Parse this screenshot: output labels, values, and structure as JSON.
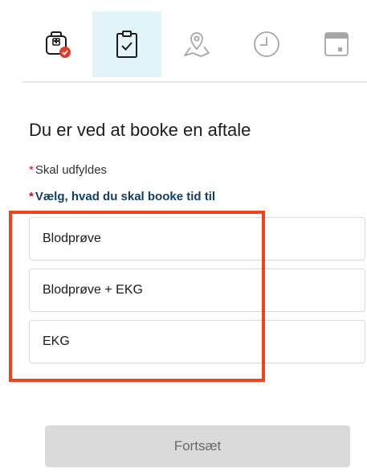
{
  "steps": [
    {
      "icon": "medical-bag-icon",
      "state": "completed"
    },
    {
      "icon": "clipboard-check-icon",
      "state": "active"
    },
    {
      "icon": "map-location-icon",
      "state": "upcoming"
    },
    {
      "icon": "clock-icon",
      "state": "upcoming"
    },
    {
      "icon": "calendar-icon",
      "state": "upcoming"
    }
  ],
  "heading": "Du er ved at booke en aftale",
  "required_note": {
    "star": "*",
    "label": "Skal udfyldes"
  },
  "question": {
    "star": "*",
    "label": "Vælg, hvad du skal booke tid til"
  },
  "options": [
    {
      "label": "Blodprøve"
    },
    {
      "label": "Blodprøve + EKG"
    },
    {
      "label": "EKG"
    }
  ],
  "continue_button": {
    "label": "Fortsæt",
    "enabled": false
  },
  "colors": {
    "active_step_bg": "#e3f3fa",
    "required_star": "#c8102e",
    "question_text": "#123e5e",
    "highlight_border": "#e8461d",
    "completed_badge": "#e0392b",
    "disabled_button_bg": "#dadada"
  }
}
